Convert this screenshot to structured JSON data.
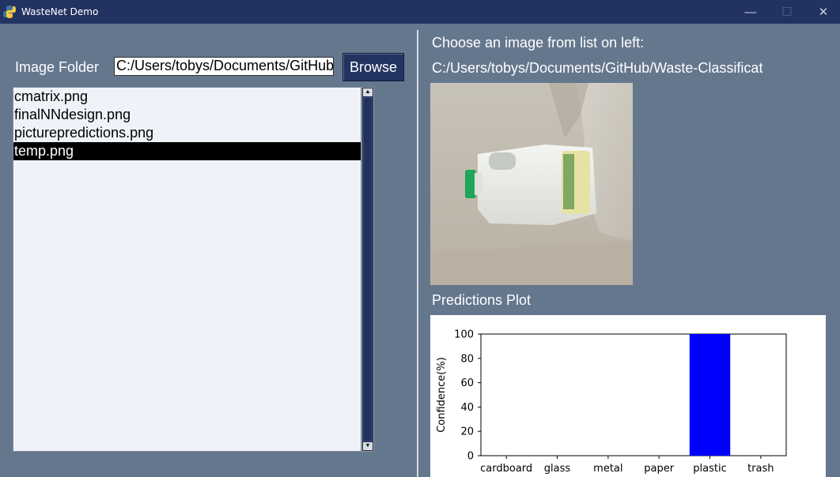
{
  "window": {
    "title": "WasteNet Demo",
    "controls": {
      "minimize": "—",
      "maximize": "☐",
      "close": "✕"
    }
  },
  "left_panel": {
    "folder_label": "Image Folder",
    "folder_value": "C:/Users/tobys/Documents/GitHub",
    "browse_label": "Browse",
    "files": [
      {
        "name": "cmatrix.png",
        "selected": false
      },
      {
        "name": "finalNNdesign.png",
        "selected": false
      },
      {
        "name": "picturepredictions.png",
        "selected": false
      },
      {
        "name": "temp.png",
        "selected": true
      }
    ]
  },
  "right_panel": {
    "choose_label": "Choose an image from list on left:",
    "image_path": "C:/Users/tobys/Documents/GitHub/Waste-Classificat",
    "predictions_label": "Predictions Plot"
  },
  "chart_data": {
    "type": "bar",
    "categories": [
      "cardboard",
      "glass",
      "metal",
      "paper",
      "plastic",
      "trash"
    ],
    "values": [
      0,
      0,
      0,
      0,
      100,
      0
    ],
    "ylabel": "Confidence(%)",
    "xlabel": "",
    "ylim": [
      0,
      100
    ],
    "yticks": [
      0,
      20,
      40,
      60,
      80,
      100
    ],
    "bar_color": "#0000ff",
    "grid": false
  }
}
